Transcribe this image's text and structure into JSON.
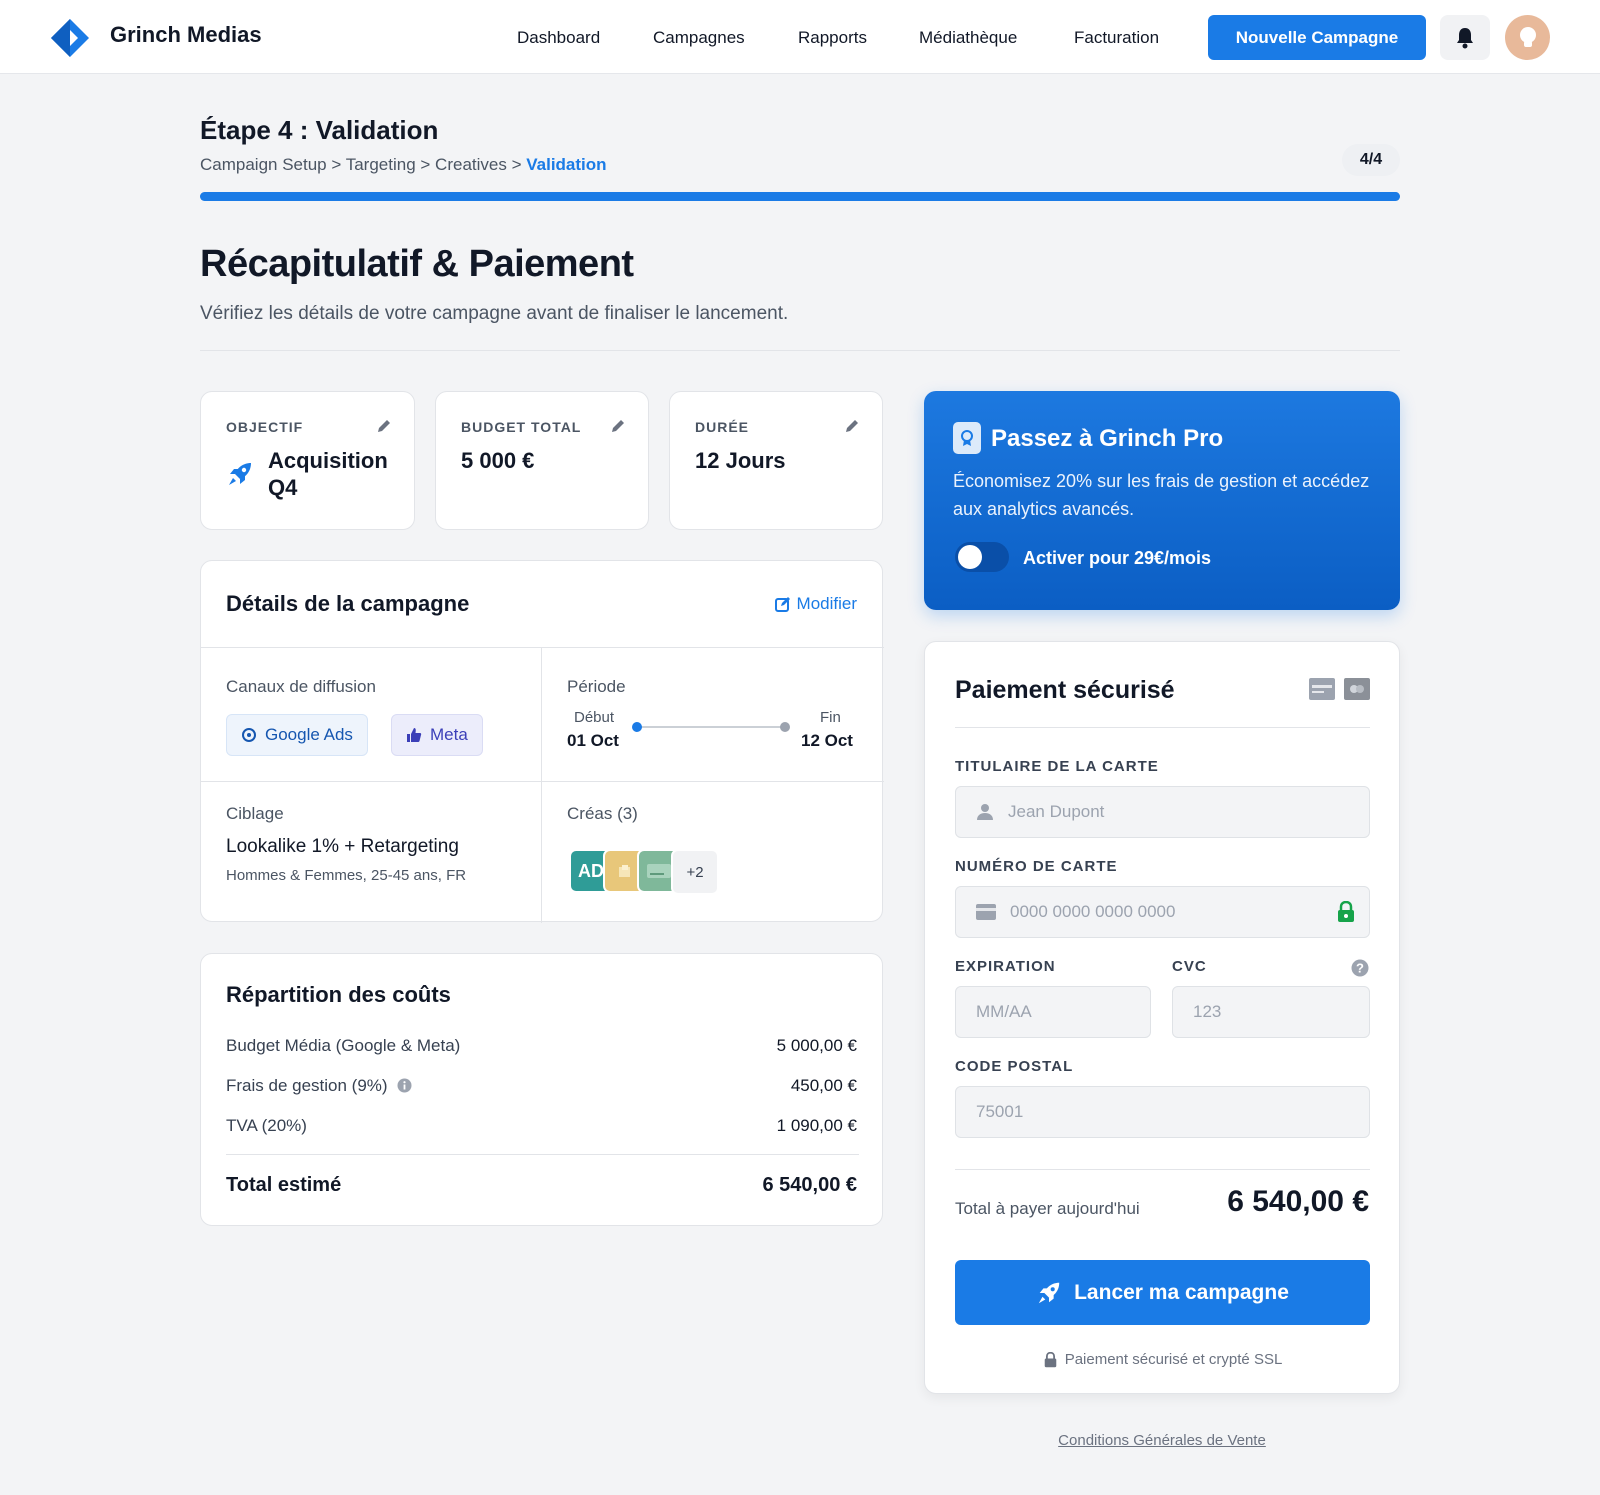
{
  "app": {
    "brand": "Grinch Medias",
    "nav": [
      "Dashboard",
      "Campagnes",
      "Rapports",
      "Médiathèque",
      "Facturation"
    ],
    "new_campaign_label": "Nouvelle Campagne"
  },
  "step": {
    "title": "Étape 4 : Validation",
    "breadcrumb": [
      "Campaign Setup",
      "Targeting",
      "Creatives",
      "Validation"
    ],
    "badge": "4/4",
    "progress_fraction": 1.0
  },
  "page": {
    "title": "Récapitulatif & Paiement",
    "subtitle": "Vérifiez les détails de votre campagne avant de finaliser le lancement."
  },
  "stats": [
    {
      "label": "OBJECTIF",
      "value_line1": "Acquisition",
      "value_line2": "Q4",
      "icon": "rocket-icon"
    },
    {
      "label": "BUDGET TOTAL",
      "value": "5 000 €"
    },
    {
      "label": "DURÉE",
      "value": "12 Jours"
    }
  ],
  "details": {
    "title": "Détails de la campagne",
    "modify_label": "Modifier",
    "channels_label": "Canaux de diffusion",
    "channels": [
      "Google Ads",
      "Meta"
    ],
    "period_label": "Période",
    "start_label": "Début",
    "start_date": "01 Oct",
    "end_label": "Fin",
    "end_date": "12 Oct",
    "targeting_label": "Ciblage",
    "targeting_value": "Lookalike 1% + Retargeting",
    "targeting_sub": "Hommes & Femmes, 25-45 ans, FR",
    "creatives_label": "Créas (3)",
    "creatives_more": "+2",
    "creative_thumb_text": "AD"
  },
  "costs": {
    "title": "Répartition des coûts",
    "rows": [
      {
        "label": "Budget Média (Google & Meta)",
        "value": "5 000,00 €"
      },
      {
        "label": "Frais de gestion (9%)",
        "value": "450,00 €"
      },
      {
        "label": "TVA (20%)",
        "value": "1 090,00 €"
      }
    ],
    "total_label": "Total estimé",
    "total_value": "6 540,00 €"
  },
  "pro": {
    "title": "Passez à Grinch Pro",
    "text": "Économisez 20% sur les frais de gestion et accédez aux analytics avancés.",
    "toggle_label": "Activer pour 29€/mois",
    "toggle_on": false
  },
  "payment": {
    "title": "Paiement sécurisé",
    "holder_label": "TITULAIRE DE LA CARTE",
    "holder_placeholder": "Jean Dupont",
    "number_label": "NUMÉRO DE CARTE",
    "number_placeholder": "0000 0000 0000 0000",
    "expiry_label": "EXPIRATION",
    "expiry_placeholder": "MM/AA",
    "cvc_label": "CVC",
    "cvc_placeholder": "123",
    "zip_label": "CODE POSTAL",
    "zip_placeholder": "75001",
    "total_label": "Total à payer aujourd'hui",
    "total_value": "6 540,00 €",
    "launch_label": "Lancer ma campagne",
    "ssl_note": "Paiement sécurisé et crypté SSL"
  },
  "footer": {
    "cgv": "Conditions Générales de Vente"
  },
  "colors": {
    "accent": "#1a7be6",
    "lock_green": "#16a34a"
  }
}
